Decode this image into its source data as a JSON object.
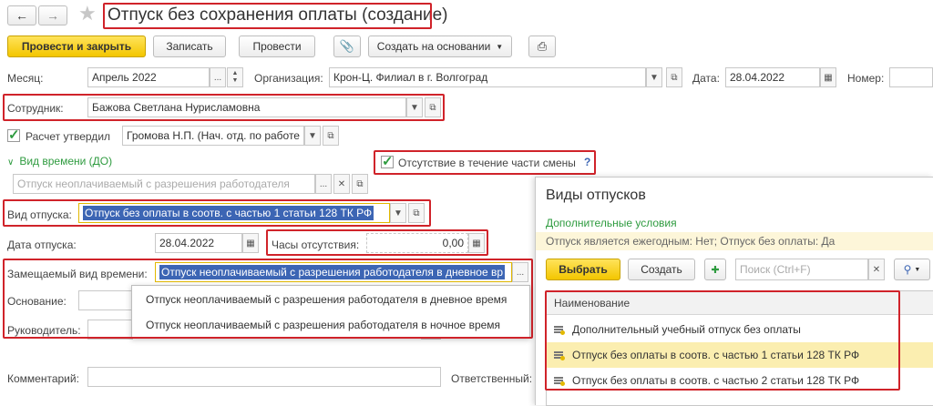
{
  "title": "Отпуск без сохранения оплаты (создание)",
  "toolbar": {
    "post_close": "Провести и закрыть",
    "save": "Записать",
    "post": "Провести",
    "create_based": "Создать на основании",
    "back_icon": "arrow-left-icon",
    "forward_icon": "arrow-right-icon",
    "star_icon": "star-icon",
    "attach_icon": "paperclip-icon",
    "print_icon": "printer-icon"
  },
  "form": {
    "month_label": "Месяц:",
    "month_value": "Апрель 2022",
    "org_label": "Организация:",
    "org_value": "Крон-Ц. Филиал в г. Волгоград",
    "date_label": "Дата:",
    "date_value": "28.04.2022",
    "number_label": "Номер:",
    "employee_label": "Сотрудник:",
    "employee_value": "Бажова Светлана Нурисламовна",
    "approved_label": "Расчет утвердил",
    "approved_value": "Громова Н.П. (Нач. отд. по работе",
    "time_type_label": "Вид времени (ДО)",
    "partial_shift_label": "Отсутствие в течение части смены",
    "help": "?",
    "time_type_placeholder": "Отпуск неоплачиваемый с разрешения работодателя",
    "leave_type_label": "Вид отпуска:",
    "leave_type_value": "Отпуск без оплаты в соотв. с частью 1 статьи 128 ТК РФ",
    "leave_date_label": "Дата отпуска:",
    "leave_date_value": "28.04.2022",
    "hours_label": "Часы отсутствия:",
    "hours_value": "0,00",
    "replaced_label": "Замещаемый вид времени:",
    "replaced_value": "Отпуск неоплачиваемый с разрешения работодателя в дневное вр",
    "basis_label": "Основание:",
    "manager_label": "Руководитель:",
    "comment_label": "Комментарий:",
    "responsible_label": "Ответственный:"
  },
  "dropdown": {
    "items": [
      "Отпуск неоплачиваемый с разрешения работодателя в дневное время",
      "Отпуск неоплачиваемый с разрешения работодателя в ночное время"
    ]
  },
  "panel": {
    "title": "Виды отпусков",
    "extra_conditions": "Дополнительные условия",
    "filter_text": "Отпуск является ежегодным: Нет; Отпуск без оплаты: Да",
    "select_btn": "Выбрать",
    "create_btn": "Создать",
    "search_placeholder": "Поиск (Ctrl+F)",
    "column": "Наименование",
    "rows": [
      "Дополнительный учебный отпуск без оплаты",
      "Отпуск без оплаты в соотв. с частью 1 статьи 128 ТК РФ",
      "Отпуск без оплаты в соотв. с частью 2 статьи 128 ТК РФ"
    ],
    "selected_row": 1
  }
}
